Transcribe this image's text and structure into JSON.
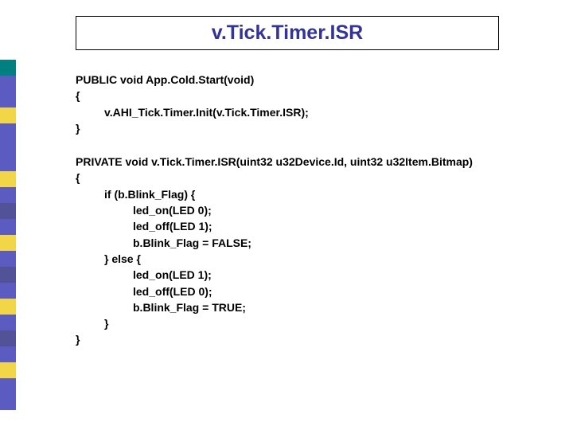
{
  "title": "v.Tick.Timer.ISR",
  "sidebar": {
    "colors": [
      "#008080",
      "#5b5bc2",
      "#5b5bc2",
      "#f2d648",
      "#5b5bc2",
      "#5b5bc2",
      "#5b5bc2",
      "#f2d648",
      "#5b5bc2",
      "#525298",
      "#5b5bc2",
      "#f2d648",
      "#5b5bc2",
      "#525298",
      "#5b5bc2",
      "#f2d648",
      "#5b5bc2",
      "#525298",
      "#5b5bc2",
      "#f2d648",
      "#5b5bc2",
      "#5b5bc2"
    ]
  },
  "code1": {
    "l1": "PUBLIC void App.Cold.Start(void)",
    "l2": "{",
    "l3": "v.AHI_Tick.Timer.Init(v.Tick.Timer.ISR);",
    "l4": "}"
  },
  "code2": {
    "l1": "PRIVATE void v.Tick.Timer.ISR(uint32 u32Device.Id, uint32 u32Item.Bitmap)",
    "l2": "{",
    "l3": "if (b.Blink_Flag) {",
    "l4": "led_on(LED 0);",
    "l5": "led_off(LED 1);",
    "l6": "b.Blink_Flag = FALSE;",
    "l7": "} else {",
    "l8": "led_on(LED 1);",
    "l9": "led_off(LED 0);",
    "l10": "b.Blink_Flag = TRUE;",
    "l11": "}",
    "l12": "}"
  }
}
